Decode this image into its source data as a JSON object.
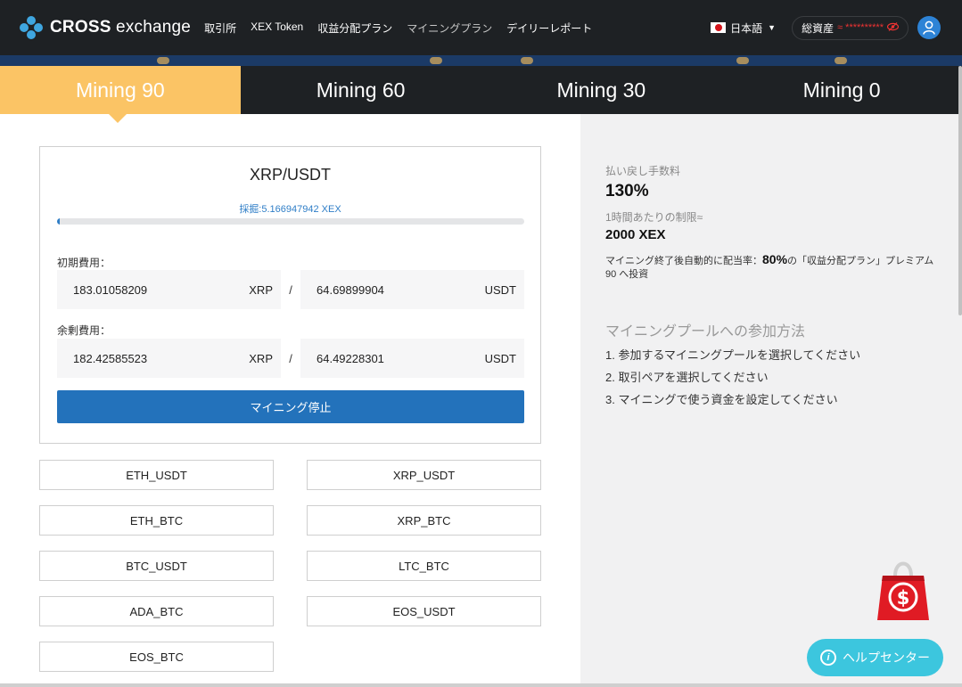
{
  "header": {
    "brand_bold": "CROSS",
    "brand_rest": " exchange",
    "nav": [
      "取引所",
      "XEX Token",
      "収益分配プラン",
      "マイニングプラン",
      "デイリーレポート"
    ],
    "language": "日本語",
    "assets_label": "総資産",
    "assets_value": "≈ **********"
  },
  "tabs": [
    "Mining 90",
    "Mining 60",
    "Mining 30",
    "Mining 0"
  ],
  "active_tab": "Mining 90",
  "card": {
    "pair": "XRP/USDT",
    "mined_label": "採掘:5.166947942 XEX",
    "progress_percent": 0.5,
    "initial_label": "初期費用：",
    "initial_xrp": "183.01058209",
    "initial_usdt": "64.69899904",
    "remaining_label": "余剰費用：",
    "remaining_xrp": "182.42585523",
    "remaining_usdt": "64.49228301",
    "unit_xrp": "XRP",
    "unit_usdt": "USDT",
    "separator": "/",
    "stop_button": "マイニング停止"
  },
  "pairs": [
    "ETH_USDT",
    "XRP_USDT",
    "ETH_BTC",
    "XRP_BTC",
    "BTC_USDT",
    "LTC_BTC",
    "ADA_BTC",
    "EOS_USDT",
    "EOS_BTC"
  ],
  "info": {
    "refund_label": "払い戻し手数料",
    "refund_value": "130%",
    "limit_label": "1時間あたりの制限≈",
    "limit_value": "2000 XEX",
    "note_prefix": "マイニング終了後自動的に配当率：",
    "note_rate": "80%",
    "note_suffix": "の「収益分配プラン」プレミアム 90 へ投資",
    "howto_title": "マイニングプールへの参加方法",
    "steps": [
      "1. 参加するマイニングプールを選択してください",
      "2. 取引ペアを選択してください",
      "3. マイニングで使う資金を設定してください"
    ]
  },
  "help": {
    "label": "ヘルプセンター",
    "icon_glyph": "i"
  },
  "colors": {
    "accent": "#fbc465",
    "primary": "#2372bb",
    "help": "#3cc6de",
    "dark": "#1e2124"
  }
}
